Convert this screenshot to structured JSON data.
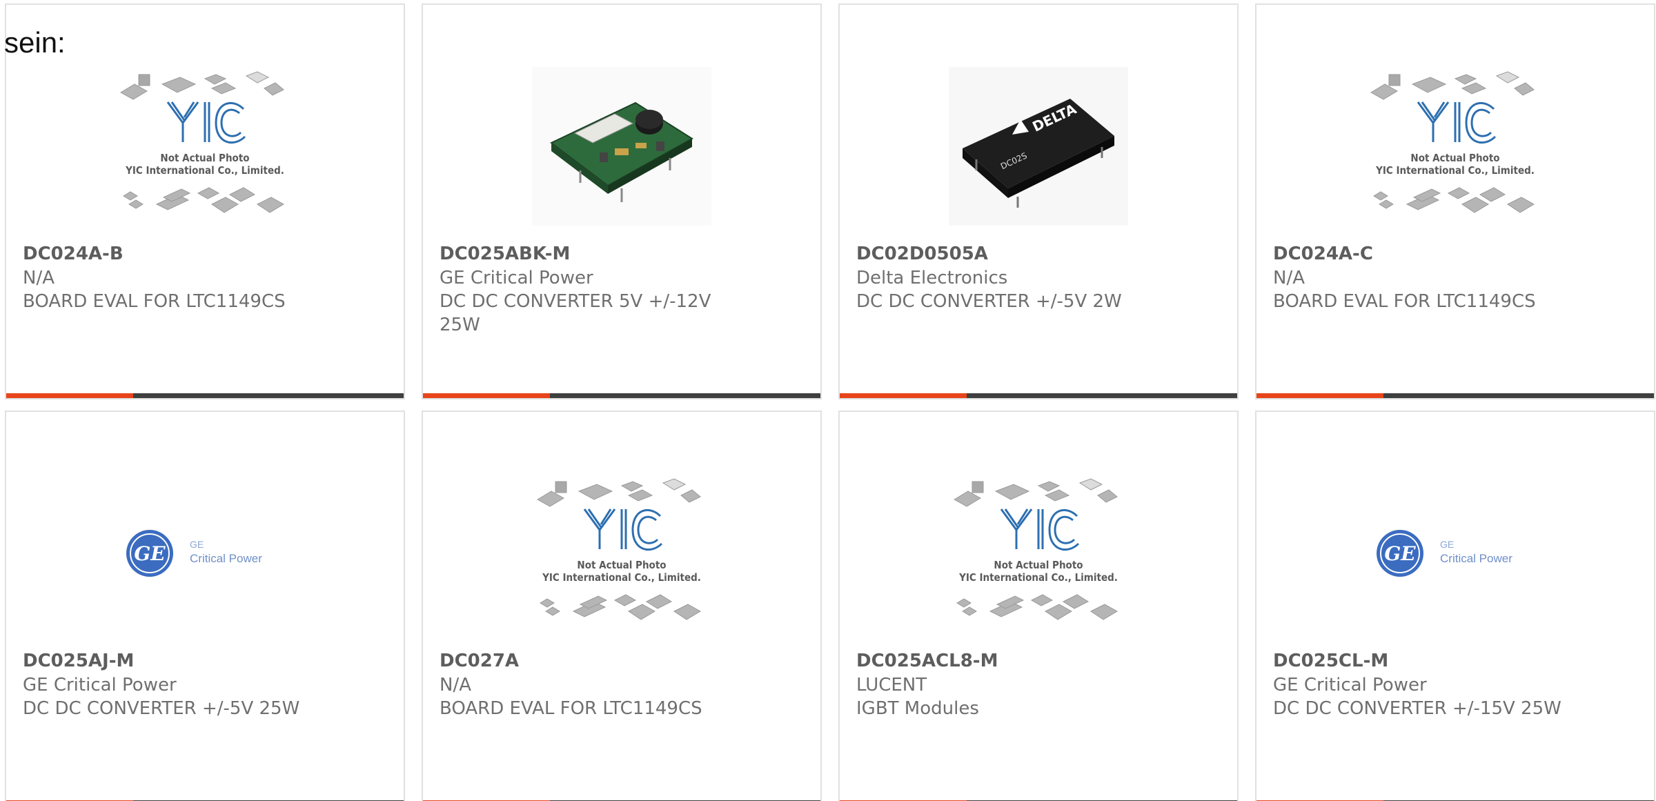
{
  "intro_text": "sein:",
  "colors": {
    "accent": "#e8441b",
    "bar_dark": "#3f3f3f",
    "border": "#e1e1e1"
  },
  "placeholder": {
    "brand": "YIC",
    "line1": "Not Actual Photo",
    "line2": "YIC International Co., Limited."
  },
  "ge_logo": {
    "line1": "GE",
    "line2": "Critical Power"
  },
  "delta_logo": {
    "brand": "DELTA",
    "model": "DC02S"
  },
  "products": [
    {
      "part": "DC024A-B",
      "manufacturer": "N/A",
      "description": "BOARD EVAL FOR LTC1149CS",
      "image": "yic-placeholder-icon"
    },
    {
      "part": "DC025ABK-M",
      "manufacturer": "GE Critical Power",
      "description": "DC DC CONVERTER 5V +/-12V 25W",
      "image": "green-circuit-board-icon"
    },
    {
      "part": "DC02D0505A",
      "manufacturer": "Delta Electronics",
      "description": "DC DC CONVERTER +/-5V 2W",
      "image": "delta-module-icon"
    },
    {
      "part": "DC024A-C",
      "manufacturer": "N/A",
      "description": "BOARD EVAL FOR LTC1149CS",
      "image": "yic-placeholder-icon"
    },
    {
      "part": "DC025AJ-M",
      "manufacturer": "GE Critical Power",
      "description": "DC DC CONVERTER +/-5V 25W",
      "image": "ge-logo-icon"
    },
    {
      "part": "DC027A",
      "manufacturer": "N/A",
      "description": "BOARD EVAL FOR LTC1149CS",
      "image": "yic-placeholder-icon"
    },
    {
      "part": "DC025ACL8-M",
      "manufacturer": "LUCENT",
      "description": "IGBT Modules",
      "image": "yic-placeholder-icon"
    },
    {
      "part": "DC025CL-M",
      "manufacturer": "GE Critical Power",
      "description": "DC DC CONVERTER +/-15V 25W",
      "image": "ge-logo-icon"
    }
  ]
}
